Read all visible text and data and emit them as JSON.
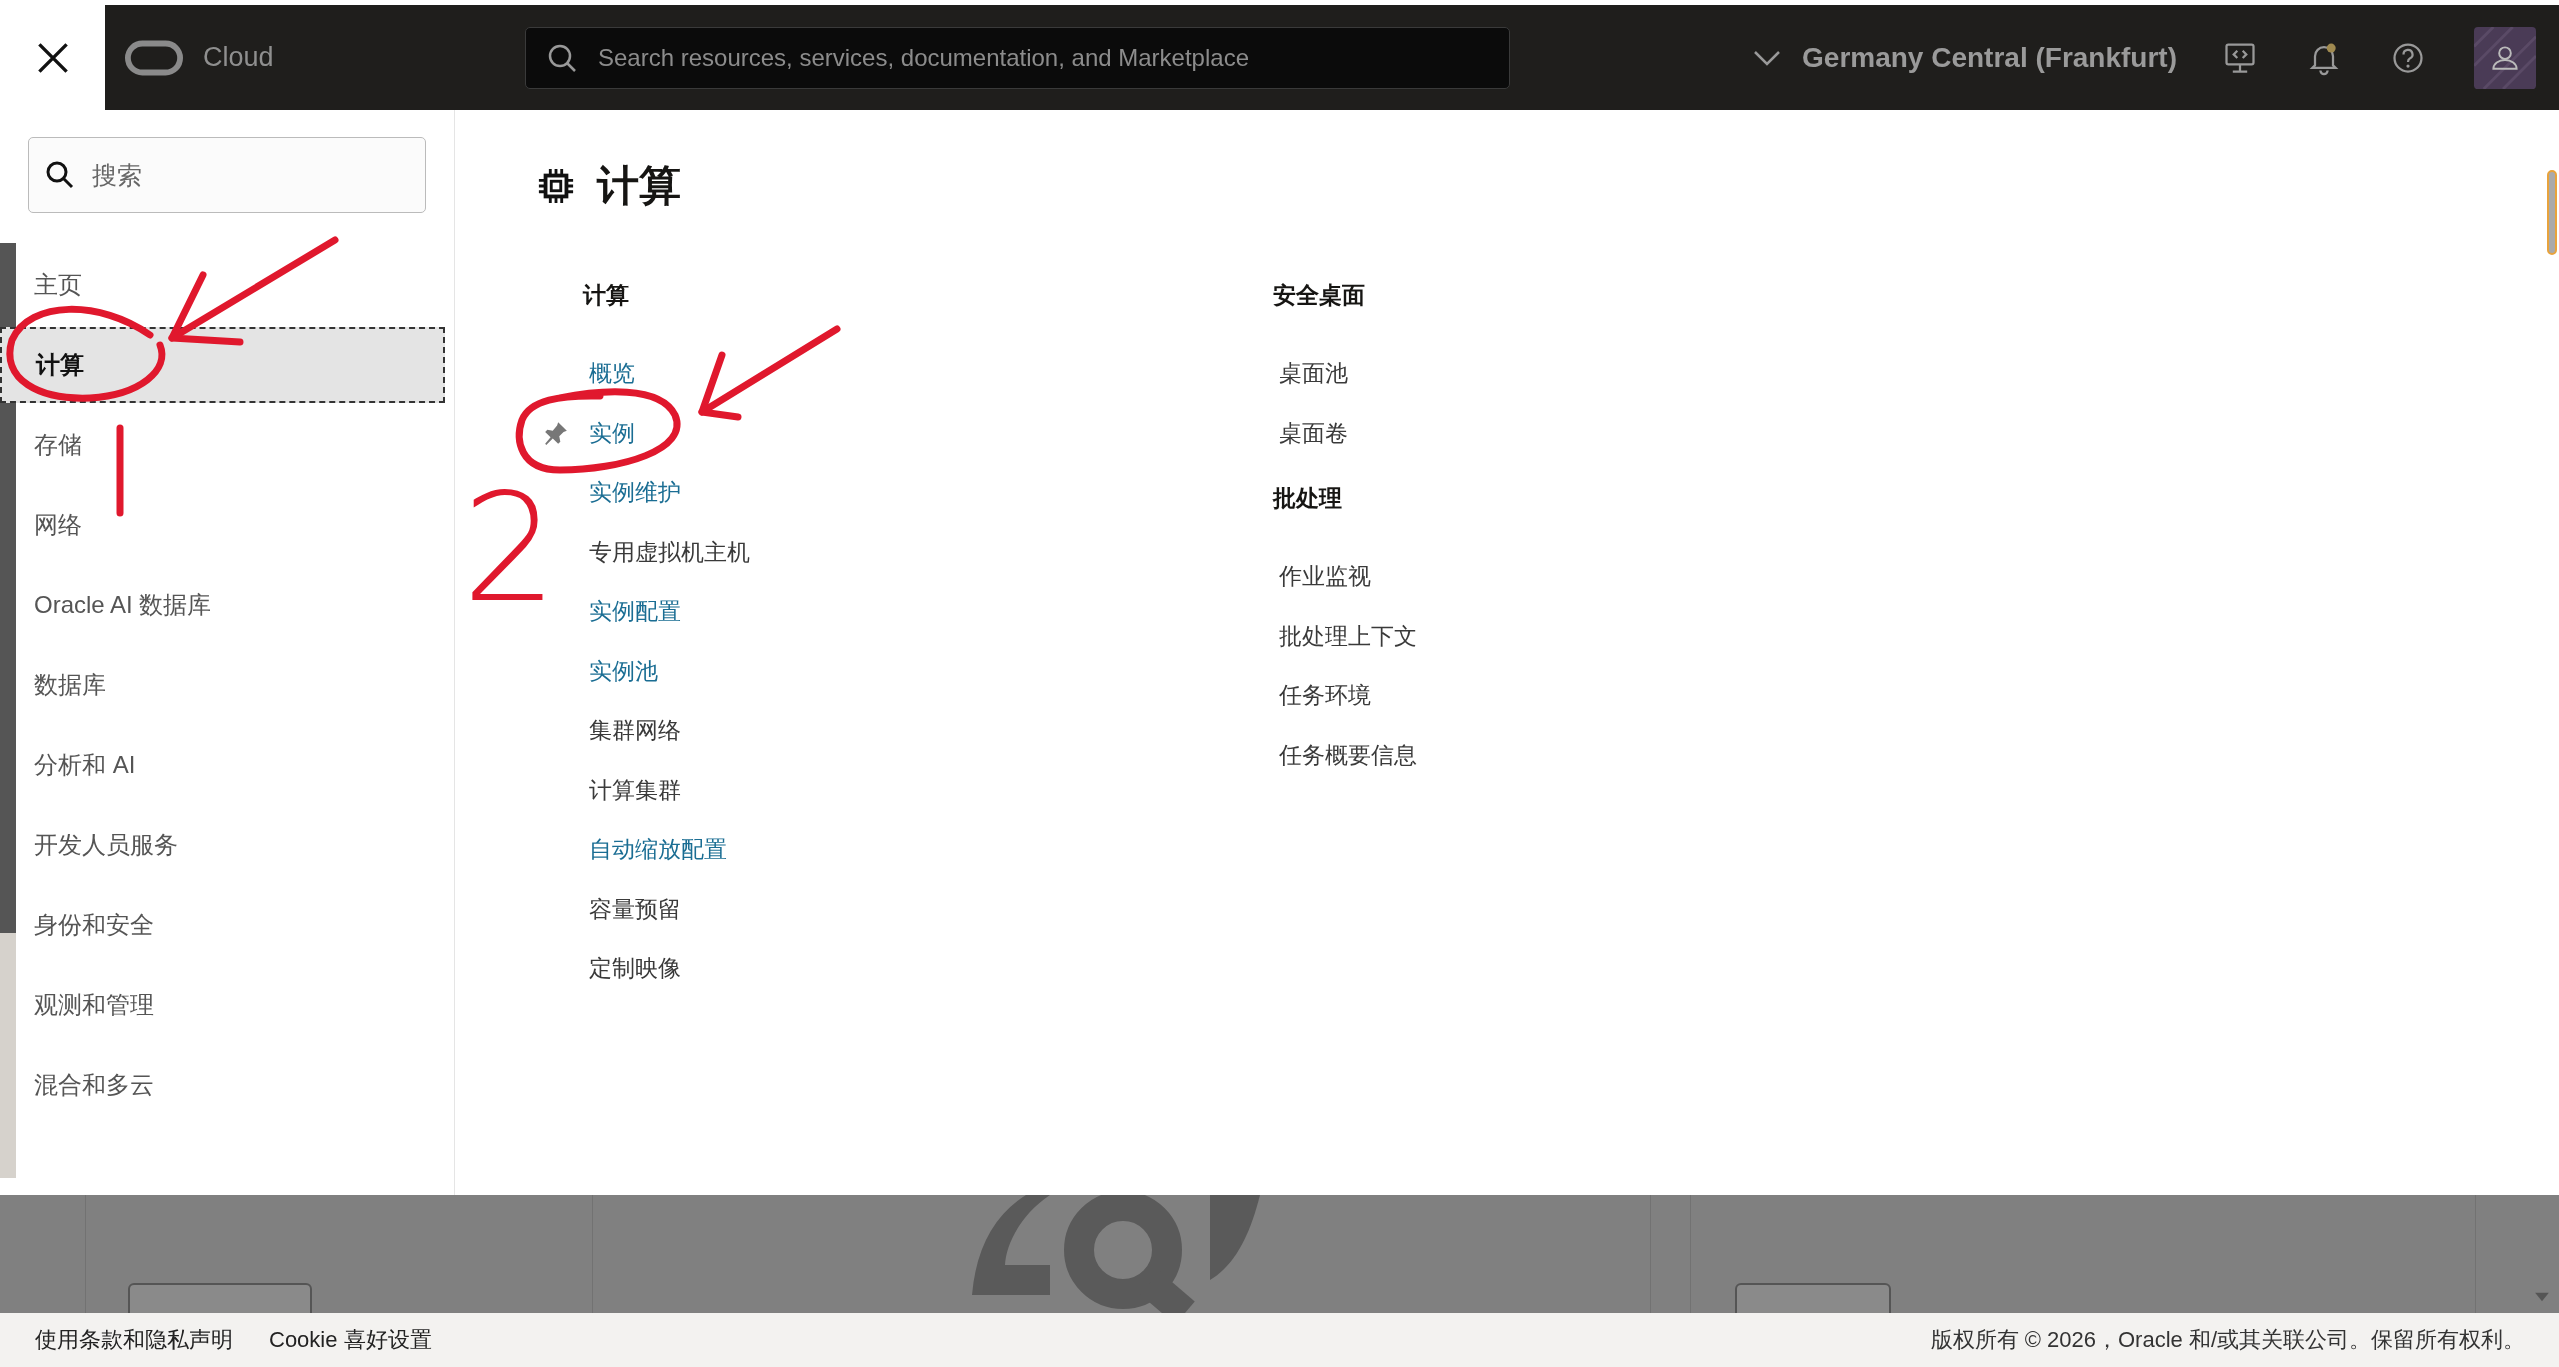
{
  "topbar": {
    "logo_text": "Cloud",
    "search": {
      "placeholder": "Search resources, services, documentation, and Marketplace"
    },
    "region": "Germany Central (Frankfurt)",
    "notification": true
  },
  "sidebar": {
    "search": {
      "placeholder": "搜索"
    },
    "items": [
      {
        "label": "主页",
        "selected": false
      },
      {
        "label": "计算",
        "selected": true
      },
      {
        "label": "存储",
        "selected": false
      },
      {
        "label": "网络",
        "selected": false
      },
      {
        "label": "Oracle AI 数据库",
        "selected": false
      },
      {
        "label": "数据库",
        "selected": false
      },
      {
        "label": "分析和 AI",
        "selected": false
      },
      {
        "label": "开发人员服务",
        "selected": false
      },
      {
        "label": "身份和安全",
        "selected": false
      },
      {
        "label": "观测和管理",
        "selected": false
      },
      {
        "label": "混合和多云",
        "selected": false
      }
    ]
  },
  "menu": {
    "title": "计算",
    "columns": [
      [
        {
          "heading": "计算",
          "items": [
            {
              "label": "概览",
              "kind": "link",
              "pinned": false
            },
            {
              "label": "实例",
              "kind": "link",
              "pinned": true
            },
            {
              "label": "实例维护",
              "kind": "link",
              "pinned": false
            },
            {
              "label": "专用虚拟机主机",
              "kind": "text",
              "pinned": false
            },
            {
              "label": "实例配置",
              "kind": "link",
              "pinned": false
            },
            {
              "label": "实例池",
              "kind": "link",
              "pinned": false
            },
            {
              "label": "集群网络",
              "kind": "text",
              "pinned": false
            },
            {
              "label": "计算集群",
              "kind": "text",
              "pinned": false
            },
            {
              "label": "自动缩放配置",
              "kind": "link",
              "pinned": false
            },
            {
              "label": "容量预留",
              "kind": "text",
              "pinned": false
            },
            {
              "label": "定制映像",
              "kind": "text",
              "pinned": false
            }
          ]
        }
      ],
      [
        {
          "heading": "安全桌面",
          "items": [
            {
              "label": "桌面池",
              "kind": "text",
              "pinned": false
            },
            {
              "label": "桌面卷",
              "kind": "text",
              "pinned": false
            }
          ]
        },
        {
          "heading": "批处理",
          "items": [
            {
              "label": "作业监视",
              "kind": "text",
              "pinned": false
            },
            {
              "label": "批处理上下文",
              "kind": "text",
              "pinned": false
            },
            {
              "label": "任务环境",
              "kind": "text",
              "pinned": false
            },
            {
              "label": "任务概要信息",
              "kind": "text",
              "pinned": false
            }
          ]
        }
      ]
    ]
  },
  "footer": {
    "links": [
      "使用条款和隐私声明",
      "Cookie 喜好设置"
    ],
    "copyright": "版权所有 © 2026，Oracle 和/或其关联公司。保留所有权利。"
  },
  "annotation": {
    "label": "2"
  }
}
